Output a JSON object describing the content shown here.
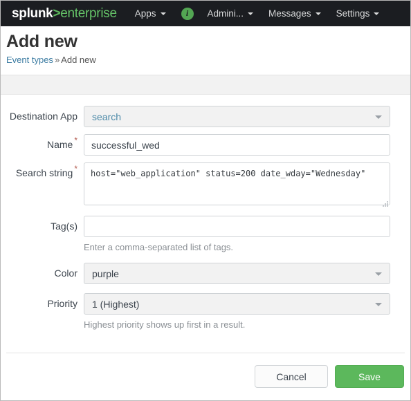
{
  "nav": {
    "logo": {
      "part1": "splunk",
      "part2": ">",
      "part3": "enterprise"
    },
    "items": [
      {
        "label": "Apps",
        "icon": "chevron-down-icon"
      },
      {
        "label": "Admini...",
        "icon": "chevron-down-icon"
      },
      {
        "label": "Messages",
        "icon": "chevron-down-icon"
      },
      {
        "label": "Settings",
        "icon": "chevron-down-icon"
      }
    ],
    "info_badge": "i"
  },
  "header": {
    "title": "Add new",
    "breadcrumb": {
      "parent": "Event types",
      "separator": "»",
      "current": "Add new"
    }
  },
  "form": {
    "destination_app": {
      "label": "Destination App",
      "value": "search",
      "required": false
    },
    "name": {
      "label": "Name",
      "required": "*",
      "value": "successful_wed",
      "placeholder": ""
    },
    "search_string": {
      "label": "Search string",
      "required": "*",
      "value": "host=\"web_application\" status=200 date_wday=\"Wednesday\"",
      "placeholder": ""
    },
    "tags": {
      "label": "Tag(s)",
      "value": "",
      "placeholder": "",
      "help": "Enter a comma-separated list of tags."
    },
    "color": {
      "label": "Color",
      "value": "purple"
    },
    "priority": {
      "label": "Priority",
      "value": "1 (Highest)",
      "help": "Highest priority shows up first in a result."
    }
  },
  "footer": {
    "cancel_label": "Cancel",
    "save_label": "Save"
  },
  "colors": {
    "navbar_bg": "#1b1d21",
    "accent_green": "#5cb85c",
    "link_blue": "#3c7ca2",
    "required_red": "#b1574b"
  }
}
